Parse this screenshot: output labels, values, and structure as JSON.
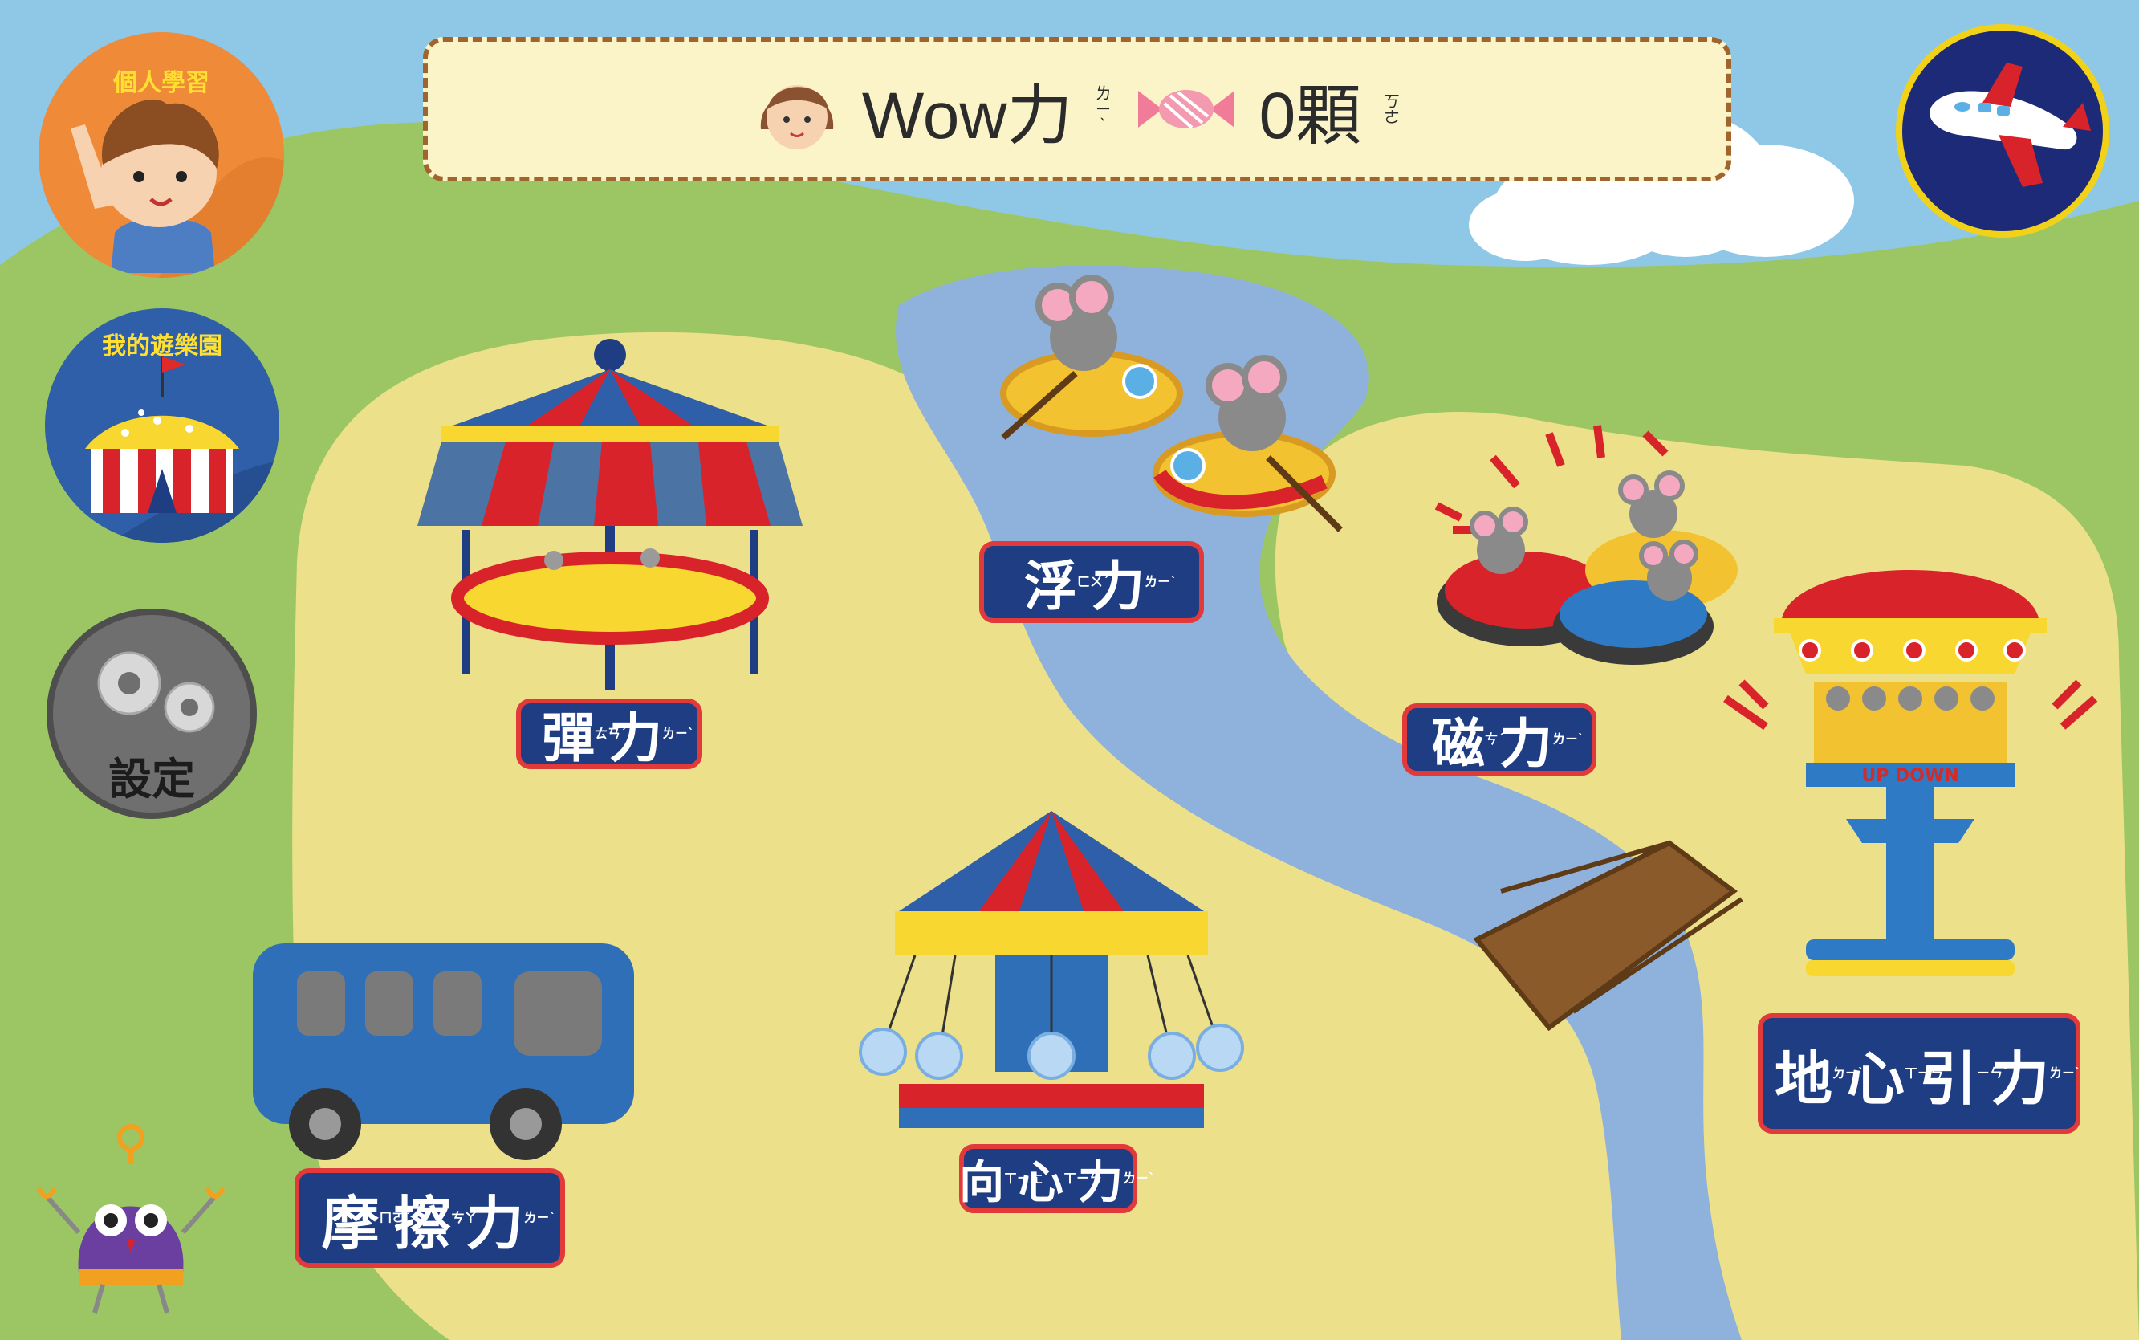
{
  "top_bar": {
    "power_label": "Wow力",
    "power_ruby": "ㄌㄧˋ",
    "candy_count": "0顆",
    "candy_ruby": "ㄎㄜ"
  },
  "side_buttons": {
    "personal_title": "個人學習",
    "park_title": "我的遊樂園",
    "settings_label": "設定"
  },
  "rides": {
    "elastic": {
      "chars": [
        "彈",
        "力"
      ],
      "rubies": [
        "ㄊㄢˊ",
        "ㄌㄧˋ"
      ]
    },
    "buoyancy": {
      "chars": [
        "浮",
        "力"
      ],
      "rubies": [
        "ㄈㄨˊ",
        "ㄌㄧˋ"
      ]
    },
    "magnetic": {
      "chars": [
        "磁",
        "力"
      ],
      "rubies": [
        "ㄘˊ",
        "ㄌㄧˋ"
      ]
    },
    "gravity": {
      "chars": [
        "地",
        "心",
        "引",
        "力"
      ],
      "rubies": [
        "ㄉㄧˋ",
        "ㄒㄧㄣ",
        "ㄧㄣˇ",
        "ㄌㄧˋ"
      ],
      "tower_text": "UP DOWN"
    },
    "friction": {
      "chars": [
        "摩",
        "擦",
        "力"
      ],
      "rubies": [
        "ㄇㄛˊ",
        "ㄘㄚ",
        "ㄌㄧˋ"
      ]
    },
    "centripetal": {
      "chars": [
        "向",
        "心",
        "力"
      ],
      "rubies": [
        "ㄒㄧㄤˋ",
        "ㄒㄧㄣ",
        "ㄌㄧˋ"
      ]
    }
  },
  "colors": {
    "sky": "#8ec8e6",
    "grass": "#9cc664",
    "sand": "#ece08a",
    "river": "#8fb2dc",
    "label_bg": "#1f3d83",
    "label_border": "#e23a3a"
  }
}
